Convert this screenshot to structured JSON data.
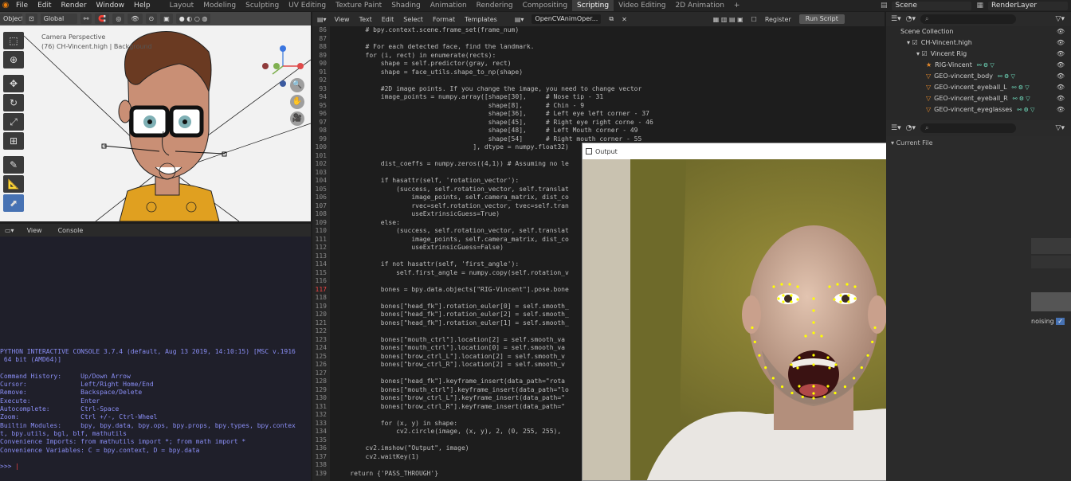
{
  "topbar": {
    "menus": [
      "File",
      "Edit",
      "Render",
      "Window",
      "Help"
    ],
    "workspaces": [
      "Layout",
      "Modeling",
      "Sculpting",
      "UV Editing",
      "Texture Paint",
      "Shading",
      "Animation",
      "Rendering",
      "Compositing",
      "Scripting",
      "Video Editing",
      "2D Animation"
    ],
    "active_workspace": "Scripting",
    "scene": "Scene",
    "view_layer": "RenderLayer"
  },
  "viewport": {
    "mode_label": "Object",
    "orientation": "Global",
    "camera_label_1": "Camera Perspective",
    "camera_label_2": "(76) CH-Vincent.high | Background",
    "tools": [
      "select-box",
      "cursor",
      "move",
      "rotate",
      "scale",
      "transform",
      "annotate",
      "measure",
      "add"
    ]
  },
  "console": {
    "tabs": [
      "View",
      "Console"
    ],
    "lines": [
      "PYTHON INTERACTIVE CONSOLE 3.7.4 (default, Aug 13 2019, 14:10:15) [MSC v.1916",
      " 64 bit (AMD64)]",
      "",
      "Command History:     Up/Down Arrow",
      "Cursor:              Left/Right Home/End",
      "Remove:              Backspace/Delete",
      "Execute:             Enter",
      "Autocomplete:        Ctrl-Space",
      "Zoom:                Ctrl +/-, Ctrl-Wheel",
      "Builtin Modules:     bpy, bpy.data, bpy.ops, bpy.props, bpy.types, bpy.contex",
      "t, bpy.utils, bgl, blf, mathutils",
      "Convenience Imports: from mathutils import *; from math import *",
      "Convenience Variables: C = bpy.context, D = bpy.data",
      ""
    ],
    "prompt": ">>> "
  },
  "editor": {
    "menus": [
      "View",
      "Text",
      "Edit",
      "Select",
      "Format",
      "Templates"
    ],
    "filename": "OpenCVAnimOper...",
    "register_label": "Register",
    "run_label": "Run Script",
    "highlight_line": 117,
    "lines": [
      [
        86,
        "        # bpy.context.scene.frame_set(frame_num)"
      ],
      [
        87,
        ""
      ],
      [
        88,
        "        # For each detected face, find the landmark."
      ],
      [
        89,
        "        for (i, rect) in enumerate(rects):"
      ],
      [
        90,
        "            shape = self.predictor(gray, rect)"
      ],
      [
        91,
        "            shape = face_utils.shape_to_np(shape)"
      ],
      [
        92,
        ""
      ],
      [
        93,
        "            #2D image points. If you change the image, you need to change vector"
      ],
      [
        94,
        "            image_points = numpy.array([shape[30],     # Nose tip - 31"
      ],
      [
        95,
        "                                        shape[8],      # Chin - 9"
      ],
      [
        96,
        "                                        shape[36],     # Left eye left corner - 37"
      ],
      [
        97,
        "                                        shape[45],     # Right eye right corne - 46"
      ],
      [
        98,
        "                                        shape[48],     # Left Mouth corner - 49"
      ],
      [
        99,
        "                                        shape[54]      # Right mouth corner - 55"
      ],
      [
        100,
        "                                    ], dtype = numpy.float32)"
      ],
      [
        101,
        ""
      ],
      [
        102,
        "            dist_coeffs = numpy.zeros((4,1)) # Assuming no le"
      ],
      [
        103,
        ""
      ],
      [
        104,
        "            if hasattr(self, 'rotation_vector'):"
      ],
      [
        105,
        "                (success, self.rotation_vector, self.translat"
      ],
      [
        106,
        "                    image_points, self.camera_matrix, dist_co"
      ],
      [
        107,
        "                    rvec=self.rotation_vector, tvec=self.tran"
      ],
      [
        108,
        "                    useExtrinsicGuess=True)"
      ],
      [
        109,
        "            else:"
      ],
      [
        110,
        "                (success, self.rotation_vector, self.translat"
      ],
      [
        111,
        "                    image_points, self.camera_matrix, dist_co"
      ],
      [
        112,
        "                    useExtrinsicGuess=False)"
      ],
      [
        113,
        ""
      ],
      [
        114,
        "            if not hasattr(self, 'first_angle'):"
      ],
      [
        115,
        "                self.first_angle = numpy.copy(self.rotation_v"
      ],
      [
        116,
        ""
      ],
      [
        117,
        "            bones = bpy.data.objects[\"RIG-Vincent\"].pose.bone"
      ],
      [
        118,
        ""
      ],
      [
        119,
        "            bones[\"head_fk\"].rotation_euler[0] = self.smooth_"
      ],
      [
        120,
        "            bones[\"head_fk\"].rotation_euler[2] = self.smooth_"
      ],
      [
        121,
        "            bones[\"head_fk\"].rotation_euler[1] = self.smooth_"
      ],
      [
        122,
        ""
      ],
      [
        123,
        "            bones[\"mouth_ctrl\"].location[2] = self.smooth_va"
      ],
      [
        124,
        "            bones[\"mouth_ctrl\"].location[0] = self.smooth_va"
      ],
      [
        125,
        "            bones[\"brow_ctrl_L\"].location[2] = self.smooth_v"
      ],
      [
        126,
        "            bones[\"brow_ctrl_R\"].location[2] = self.smooth_v"
      ],
      [
        127,
        ""
      ],
      [
        128,
        "            bones[\"head_fk\"].keyframe_insert(data_path=\"rota"
      ],
      [
        129,
        "            bones[\"mouth_ctrl\"].keyframe_insert(data_path=\"lo"
      ],
      [
        130,
        "            bones[\"brow_ctrl_L\"].keyframe_insert(data_path=\""
      ],
      [
        131,
        "            bones[\"brow_ctrl_R\"].keyframe_insert(data_path=\""
      ],
      [
        132,
        ""
      ],
      [
        133,
        "            for (x, y) in shape:"
      ],
      [
        134,
        "                cv2.circle(image, (x, y), 2, (0, 255, 255),"
      ],
      [
        135,
        ""
      ],
      [
        136,
        "        cv2.imshow(\"Output\", image)"
      ],
      [
        137,
        "        cv2.waitKey(1)"
      ],
      [
        138,
        ""
      ],
      [
        139,
        "    return {'PASS_THROUGH'}"
      ]
    ]
  },
  "output_window": {
    "title": "Output",
    "controls": [
      "—",
      "☐",
      "✕"
    ]
  },
  "outliner": {
    "search_placeholder": "",
    "items": [
      {
        "label": "Scene Collection",
        "indent": 0
      },
      {
        "label": "CH-Vincent.high",
        "indent": 1
      },
      {
        "label": "Vincent Rig",
        "indent": 2
      },
      {
        "label": "RIG-Vincent",
        "indent": 3
      },
      {
        "label": "GEO-vincent_body",
        "indent": 3
      },
      {
        "label": "GEO-vincent_eyeball_L",
        "indent": 3
      },
      {
        "label": "GEO-vincent_eyeball_R",
        "indent": 3
      },
      {
        "label": "GEO-vincent_eyeglasses",
        "indent": 3
      }
    ]
  },
  "properties": {
    "current_file": "Current File",
    "denoising_label": "noising"
  },
  "colors": {
    "accent": "#4772b3",
    "blender_orange": "#e87d0d",
    "console_text": "#8a8ef5",
    "landmark": "#ffff00"
  }
}
